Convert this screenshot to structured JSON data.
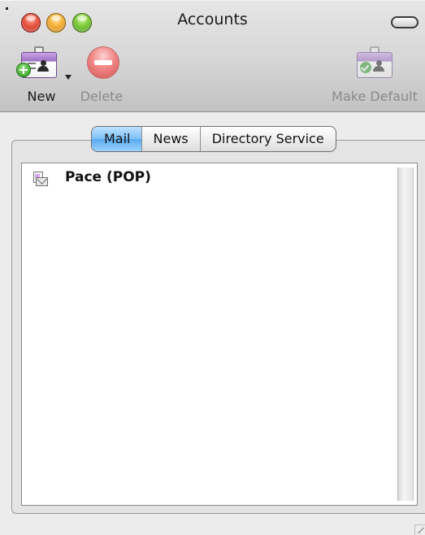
{
  "window": {
    "title": "Accounts"
  },
  "toolbar": {
    "new_label": "New",
    "delete_label": "Delete",
    "make_default_label": "Make Default"
  },
  "tabs": [
    {
      "label": "Mail",
      "selected": true
    },
    {
      "label": "News",
      "selected": false
    },
    {
      "label": "Directory Service",
      "selected": false
    }
  ],
  "accounts": [
    {
      "name": "Pace (POP)",
      "icon": "mail-account-icon"
    }
  ],
  "colors": {
    "close": "#e8543f",
    "minimize": "#f5b23a",
    "zoom": "#7ecb3a",
    "selected_tab": "#7cc0f7"
  }
}
